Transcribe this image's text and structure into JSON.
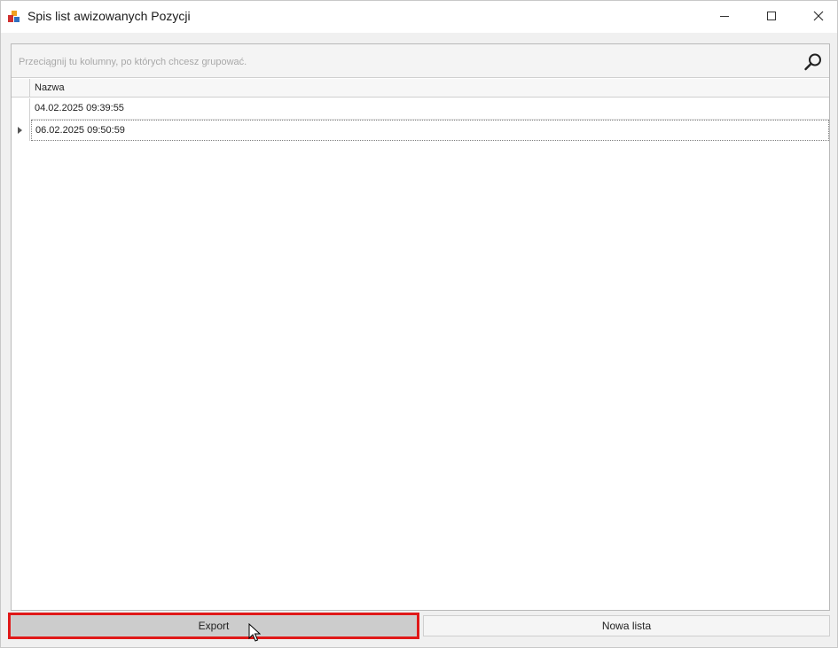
{
  "window": {
    "title": "Spis list awizowanych Pozycji",
    "controls": {
      "minimize": "—",
      "maximize": "☐",
      "close": "✕"
    }
  },
  "grid": {
    "group_hint": "Przeciągnij tu kolumny, po których chcesz grupować.",
    "columns": [
      "Nazwa"
    ],
    "rows": [
      {
        "nazwa": "04.02.2025 09:39:55",
        "selected": false
      },
      {
        "nazwa": "06.02.2025 09:50:59",
        "selected": true
      }
    ]
  },
  "buttons": {
    "export_label": "Export",
    "new_list_label": "Nowa lista"
  },
  "colors": {
    "highlight": "#e01818",
    "export_bg": "#cccccc"
  },
  "icons": [
    "app-icon",
    "search-icon",
    "row-indicator-arrow-icon",
    "mouse-cursor-icon"
  ]
}
